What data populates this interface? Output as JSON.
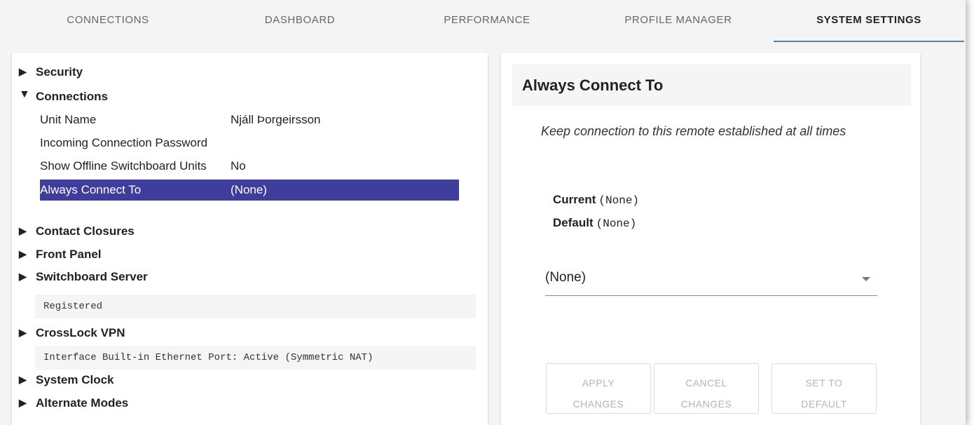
{
  "tabs": [
    {
      "label": "CONNECTIONS"
    },
    {
      "label": "DASHBOARD"
    },
    {
      "label": "PERFORMANCE"
    },
    {
      "label": "PROFILE MANAGER"
    },
    {
      "label": "SYSTEM SETTINGS",
      "active": true
    }
  ],
  "tree": {
    "security": {
      "label": "Security"
    },
    "connections": {
      "label": "Connections",
      "rows": [
        {
          "key": "Unit Name",
          "value": "Njáll Þorgeirsson"
        },
        {
          "key": "Incoming Connection Password",
          "value": ""
        },
        {
          "key": "Show Offline Switchboard Units",
          "value": "No"
        },
        {
          "key": "Always Connect To",
          "value": "(None)",
          "selected": true
        }
      ]
    },
    "contact_closures": {
      "label": "Contact Closures"
    },
    "front_panel": {
      "label": "Front Panel"
    },
    "switchboard_server": {
      "label": "Switchboard Server",
      "status": "Registered"
    },
    "crosslock_vpn": {
      "label": "CrossLock VPN",
      "status": "Interface Built-in Ethernet Port: Active (Symmetric NAT)"
    },
    "system_clock": {
      "label": "System Clock"
    },
    "alternate_modes": {
      "label": "Alternate Modes"
    }
  },
  "detail": {
    "title": "Always Connect To",
    "description": "Keep connection to this remote established at all times",
    "current_label": "Current",
    "current_value": "(None)",
    "default_label": "Default",
    "default_value": "(None)",
    "select_value": "(None)",
    "buttons": {
      "apply_line1": "APPLY",
      "apply_line2": "CHANGES",
      "cancel_line1": "CANCEL",
      "cancel_line2": "CHANGES",
      "default_line1": "SET TO",
      "default_line2": "DEFAULT"
    }
  },
  "colors": {
    "selected_row": "#3e3d9b",
    "tab_underline": "#5a7ea6"
  }
}
